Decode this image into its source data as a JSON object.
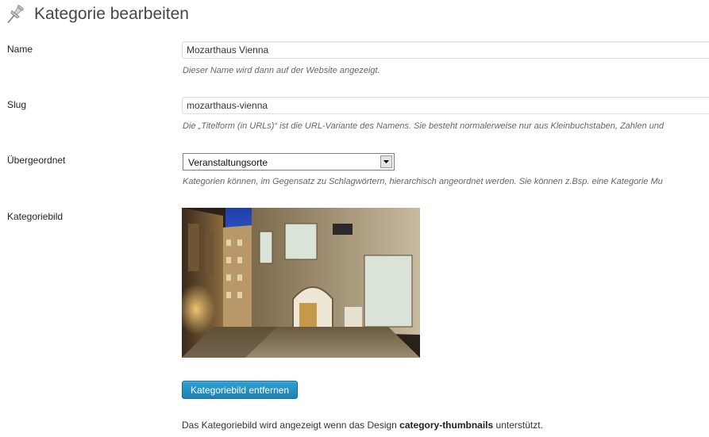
{
  "header": {
    "title": "Kategorie bearbeiten",
    "icon": "pin-icon"
  },
  "form": {
    "name": {
      "label": "Name",
      "value": "Mozarthaus Vienna",
      "description": "Dieser Name wird dann auf der Website angezeigt."
    },
    "slug": {
      "label": "Slug",
      "value": "mozarthaus-vienna",
      "description": "Die „Titelform (in URLs)“ ist die URL-Variante des Namens. Sie besteht normalerweise nur aus Kleinbuchstaben, Zahlen und"
    },
    "parent": {
      "label": "Übergeordnet",
      "selected": "Veranstaltungsorte",
      "description": "Kategorien können, im Gegensatz zu Schlagwörtern, hierarchisch angeordnet werden. Sie können z.Bsp. eine Kategorie Mu"
    },
    "image": {
      "label": "Kategoriebild",
      "remove_button": "Kategoriebild entfernen",
      "note_prefix": "Das Kategoriebild wird angezeigt wenn das Design ",
      "note_bold": "category-thumbnails",
      "note_suffix": " unterstützt."
    }
  },
  "colors": {
    "button": "#2a95c5",
    "title": "#464646",
    "description": "#666666"
  }
}
